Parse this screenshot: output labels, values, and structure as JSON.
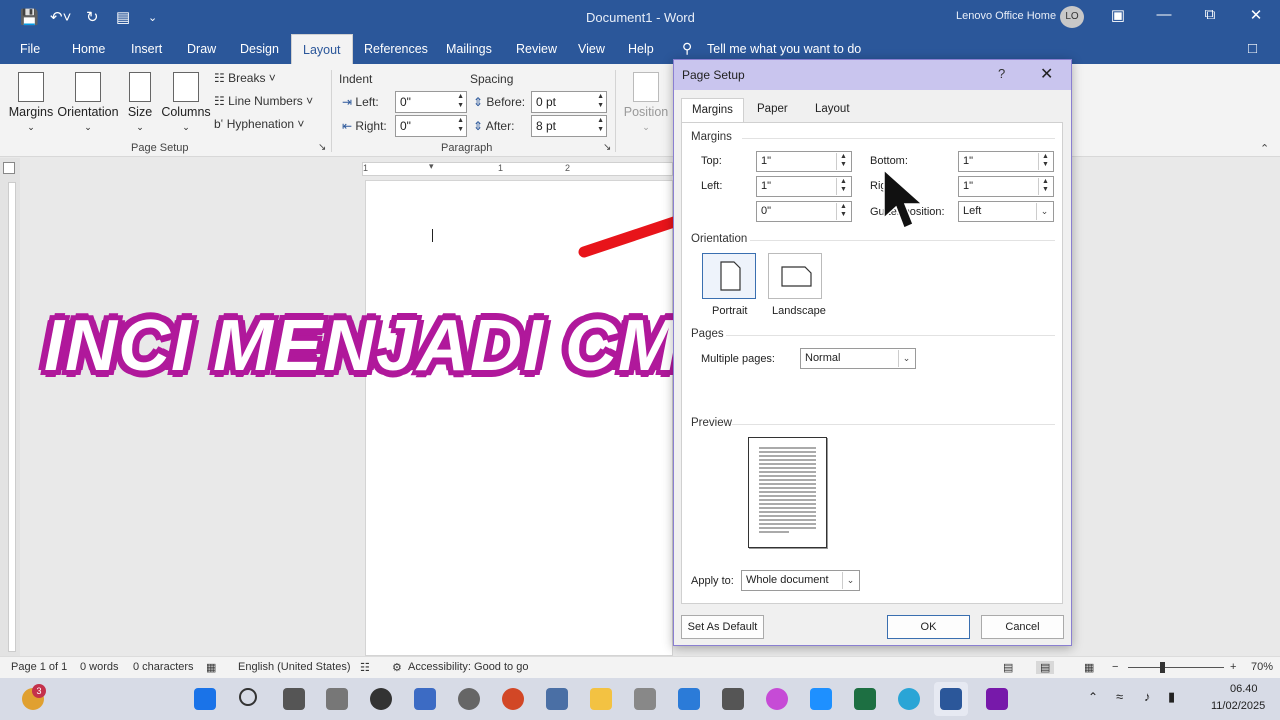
{
  "titlebar": {
    "doc_title": "Document1 - Word",
    "account": "Lenovo Office Home",
    "avatar": "LO",
    "quick_access": [
      "save-icon",
      "undo-icon",
      "redo-icon",
      "clipboard-icon"
    ]
  },
  "tabs": [
    "File",
    "Home",
    "Insert",
    "Draw",
    "Design",
    "Layout",
    "References",
    "Mailings",
    "Review",
    "View",
    "Help"
  ],
  "active_tab": "Layout",
  "tell_me": "Tell me what you want to do",
  "ribbon": {
    "margins": "Margins",
    "orientation": "Orientation",
    "size": "Size",
    "columns": "Columns",
    "breaks": "Breaks",
    "line_numbers": "Line Numbers",
    "hyphenation": "Hyphenation",
    "page_setup_group": "Page Setup",
    "indent": "Indent",
    "spacing": "Spacing",
    "left_label": "Left:",
    "right_label": "Right:",
    "indent_left": "0\"",
    "indent_right": "0\"",
    "before_label": "Before:",
    "after_label": "After:",
    "spacing_before": "0 pt",
    "spacing_after": "8 pt",
    "paragraph_group": "Paragraph",
    "position": "Position",
    "ruler_marks": [
      "1",
      "1",
      "2"
    ]
  },
  "overlay_text": "INCI  MENJADI  CM",
  "dialog": {
    "title": "Page Setup",
    "help": "?",
    "tabs": [
      "Margins",
      "Paper",
      "Layout"
    ],
    "margins_section": "Margins",
    "top_label": "Top:",
    "top_value": "1\"",
    "bottom_label": "Bottom:",
    "bottom_value": "1\"",
    "left_label": "Left:",
    "left_value": "1\"",
    "right_label": "Right:",
    "right_value": "1\"",
    "gutter_value": "0\"",
    "gutter_position_label": "Gutter position:",
    "gutter_position_value": "Left",
    "orientation_section": "Orientation",
    "portrait": "Portrait",
    "landscape": "Landscape",
    "pages_section": "Pages",
    "multiple_pages_label": "Multiple pages:",
    "multiple_pages_value": "Normal",
    "preview_section": "Preview",
    "apply_to_label": "Apply to:",
    "apply_to_value": "Whole document",
    "set_default": "Set As Default",
    "ok": "OK",
    "cancel": "Cancel"
  },
  "statusbar": {
    "page": "Page 1 of 1",
    "words": "0 words",
    "characters": "0 characters",
    "language": "English (United States)",
    "accessibility": "Accessibility: Good to go",
    "zoom": "70%",
    "zoom_minus": "−",
    "zoom_plus": "+"
  },
  "taskbar": {
    "time": "06.40",
    "date": "11/02/2025",
    "badge": "3"
  },
  "colors": {
    "word_blue": "#2b579a",
    "overlay_magenta": "#b0189b",
    "arrow_red": "#e8141a"
  }
}
